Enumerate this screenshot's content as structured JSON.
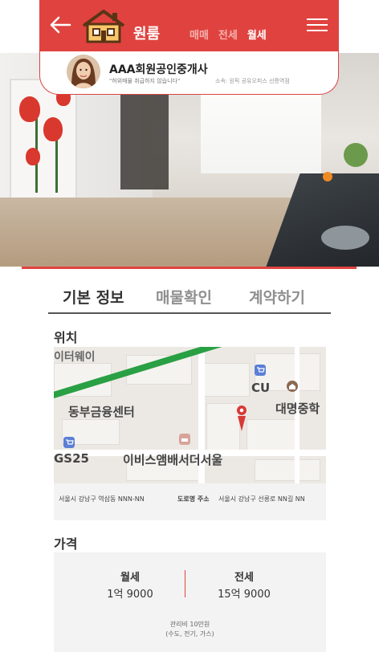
{
  "header": {
    "brand": "원룸",
    "tabs": [
      "매매",
      "전세",
      "월세"
    ],
    "active_tab": "월세",
    "accent_color": "#e0433f"
  },
  "agent": {
    "name": "AAA회원공인중개사",
    "quote": "\"허위매물 취급하지 않습니다\"",
    "office": "소속: 원픽 공유오피스 선릉역점"
  },
  "section_tabs": [
    "기본 정보",
    "매물확인",
    "계약하기"
  ],
  "location": {
    "title": "위치",
    "map_labels": {
      "subway": "이터웨이",
      "finance": "동부금융센터",
      "cu": "CU",
      "daemyung": "대명중학",
      "gs": "GS25",
      "ibis": "이비스앰배서더서울"
    },
    "address_jibun": "서울시 강남구 역삼동 NNN-NN",
    "road_label": "도로명 주소",
    "address_road": "서울시 강남구 선릉로 NN길 NN"
  },
  "price": {
    "title": "가격",
    "monthly_label": "월세",
    "monthly_value": "1억 9000",
    "jeonse_label": "전세",
    "jeonse_value": "15억 9000",
    "fee_line1": "관리비 10만원",
    "fee_line2": "(수도, 전기, 가스)"
  }
}
